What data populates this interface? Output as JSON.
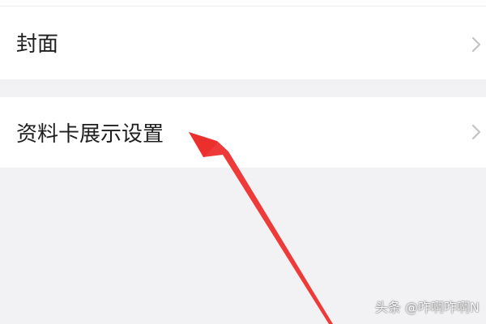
{
  "settings": {
    "items": [
      {
        "label": "封面",
        "icon": "chevron-right-icon"
      },
      {
        "label": "资料卡展示设置",
        "icon": "chevron-right-icon"
      }
    ]
  },
  "annotation": {
    "arrow_color": "#ee3a38",
    "arrow_icon": "red-arrow-annotation"
  },
  "watermark": {
    "text": "头条 @咋啊咋啊N"
  },
  "colors": {
    "background": "#f2f2f5",
    "row_background": "#ffffff",
    "text": "#1e1e1e",
    "chevron": "#c4c4c8"
  }
}
